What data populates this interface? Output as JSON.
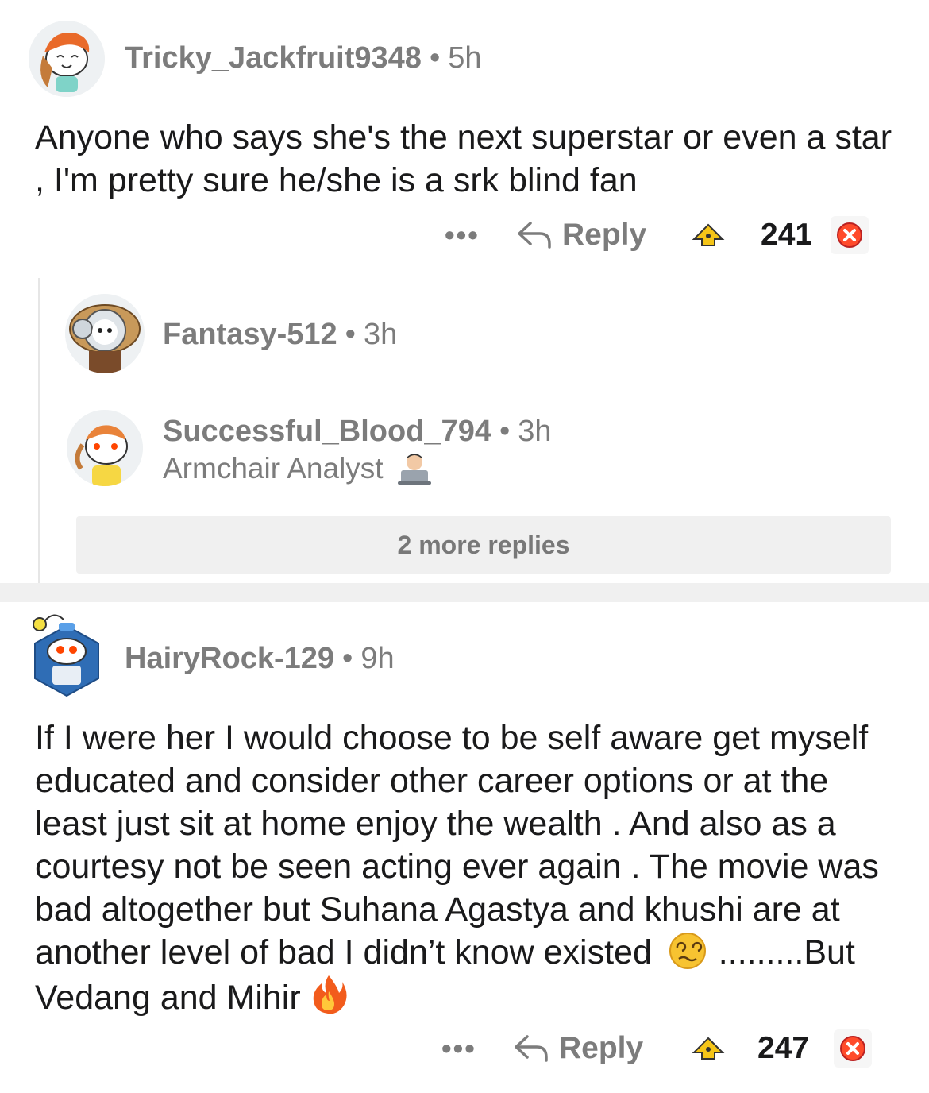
{
  "comments": [
    {
      "username": "Tricky_Jackfruit9348",
      "separator": "•",
      "age": "5h",
      "body": "Anyone who says she's the next superstar or even a star , I'm pretty sure he/she is a srk blind fan",
      "actions": {
        "more": "•••",
        "reply": "Reply",
        "score": "241"
      }
    },
    {
      "username": "HairyRock-129",
      "separator": "•",
      "age": "9h",
      "body_main": "If I were her I would choose to be self aware get myself educated and consider other career options or at the least just sit at home enjoy the wealth . And also as a courtesy not be seen acting ever again . The movie was bad altogether but Suhana Agastya and khushi are at another level of bad I didn’t know existed",
      "body_tail": "  .........But Vedang and Mihir",
      "actions": {
        "more": "•••",
        "reply": "Reply",
        "score": "247"
      }
    }
  ],
  "replies": [
    {
      "username": "Fantasy-512",
      "separator": "•",
      "age": "3h"
    },
    {
      "username": "Successful_Blood_794",
      "separator": "•",
      "age": "3h",
      "flair": "Armchair Analyst"
    }
  ],
  "more_replies": "2 more replies",
  "colors": {
    "meta": "#7c7c7c",
    "text": "#1a1a1b",
    "upvote": "#f5c518",
    "downvote": "#ff4b2b"
  },
  "icons": [
    "reply-arrow-icon",
    "upvote-icon",
    "downvote-icon",
    "laptop-emoji-icon",
    "dizzy-face-emoji-icon",
    "fire-emoji-icon"
  ]
}
